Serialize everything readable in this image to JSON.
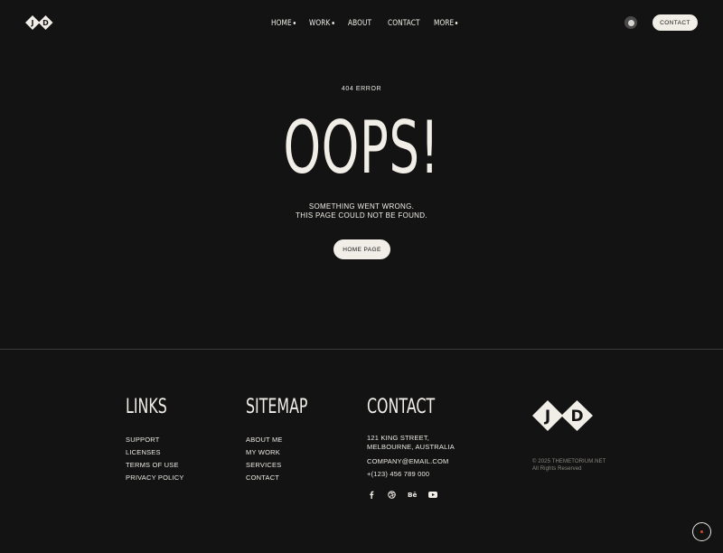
{
  "header": {
    "logo_text": {
      "left": "J",
      "right": "D"
    },
    "nav": [
      {
        "label": "HOME",
        "has_dropdown": true
      },
      {
        "label": "WORK",
        "has_dropdown": true
      },
      {
        "label": "ABOUT",
        "has_dropdown": false
      },
      {
        "label": "CONTACT",
        "has_dropdown": false
      },
      {
        "label": "MORE",
        "has_dropdown": true
      }
    ],
    "theme_toggle_icon": "theme-toggle-icon",
    "contact_button": "CONTACT"
  },
  "hero": {
    "eyebrow": "404 ERROR",
    "title": "OOPS!",
    "message_line1": "SOMETHING WENT WRONG.",
    "message_line2": "THIS PAGE COULD NOT BE FOUND.",
    "button_label": "HOME PAGE"
  },
  "footer": {
    "links": {
      "heading": "LINKS",
      "items": [
        "SUPPORT",
        "LICENSES",
        "TERMS OF USE",
        "PRIVACY POLICY"
      ]
    },
    "sitemap": {
      "heading": "SITEMAP",
      "items": [
        "ABOUT ME",
        "MY WORK",
        "SERVICES",
        "CONTACT"
      ]
    },
    "contact": {
      "heading": "CONTACT",
      "address_line1": "121 KING STREET,",
      "address_line2": "MELBOURNE, AUSTRALIA",
      "email": "COMPANY@EMAIL.COM",
      "phone": "+(123) 456 789 000",
      "socials": [
        "facebook-icon",
        "dribbble-icon",
        "behance-icon",
        "youtube-icon"
      ]
    },
    "logo_text": {
      "left": "J",
      "right": "D"
    },
    "copyright_line1": "© 2025 THEMETORIUM.NET",
    "copyright_line2": "All Rights Reserved"
  },
  "colors": {
    "background": "#131313",
    "foreground": "#f1eee8",
    "divider": "#3a3a3a",
    "muted": "#8a8782",
    "accent_dot": "#d0492a"
  }
}
